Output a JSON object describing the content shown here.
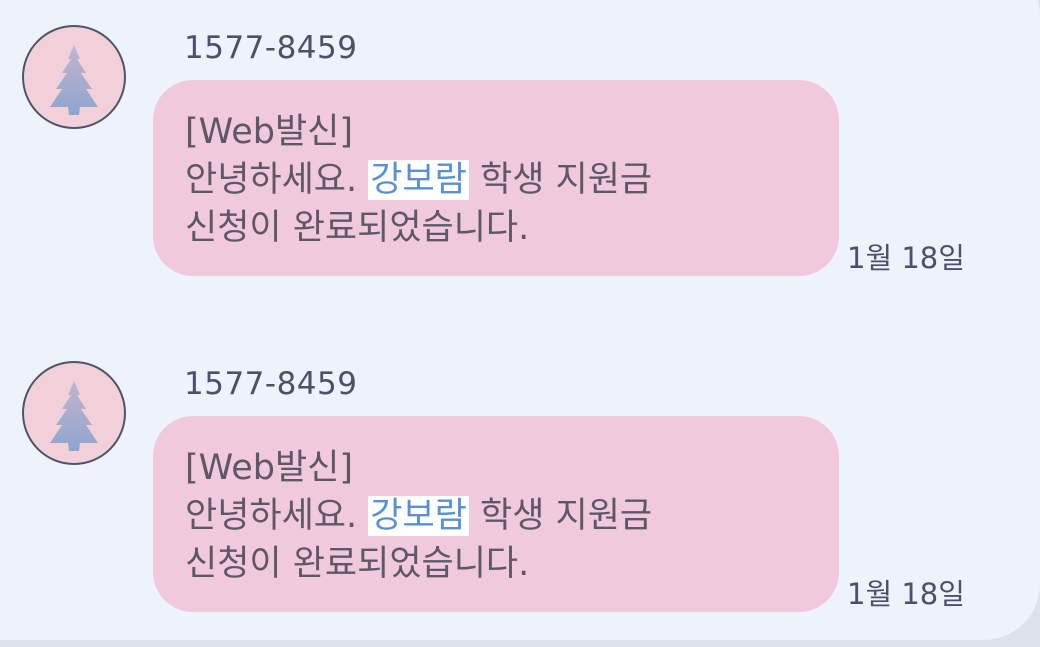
{
  "messages": [
    {
      "sender": "1577-8459",
      "line1": "[Web발신]",
      "line2_prefix": "안녕하세요. ",
      "line2_highlight": "강보람",
      "line2_suffix": " 학생 지원금",
      "line3": "신청이 완료되었습니다.",
      "time": "1월 18일",
      "avatar_icon": "tree-icon"
    },
    {
      "sender": "1577-8459",
      "line1": "[Web발신]",
      "line2_prefix": "안녕하세요. ",
      "line2_highlight": "강보람",
      "line2_suffix": " 학생 지원금",
      "line3": "신청이 완료되었습니다.",
      "time": "1월 18일",
      "avatar_icon": "tree-icon"
    }
  ],
  "colors": {
    "background": "#edf2fb",
    "bubble": "#f0c9dc",
    "highlight_text": "#5a90d4",
    "avatar_bg": "#f1d0da"
  }
}
